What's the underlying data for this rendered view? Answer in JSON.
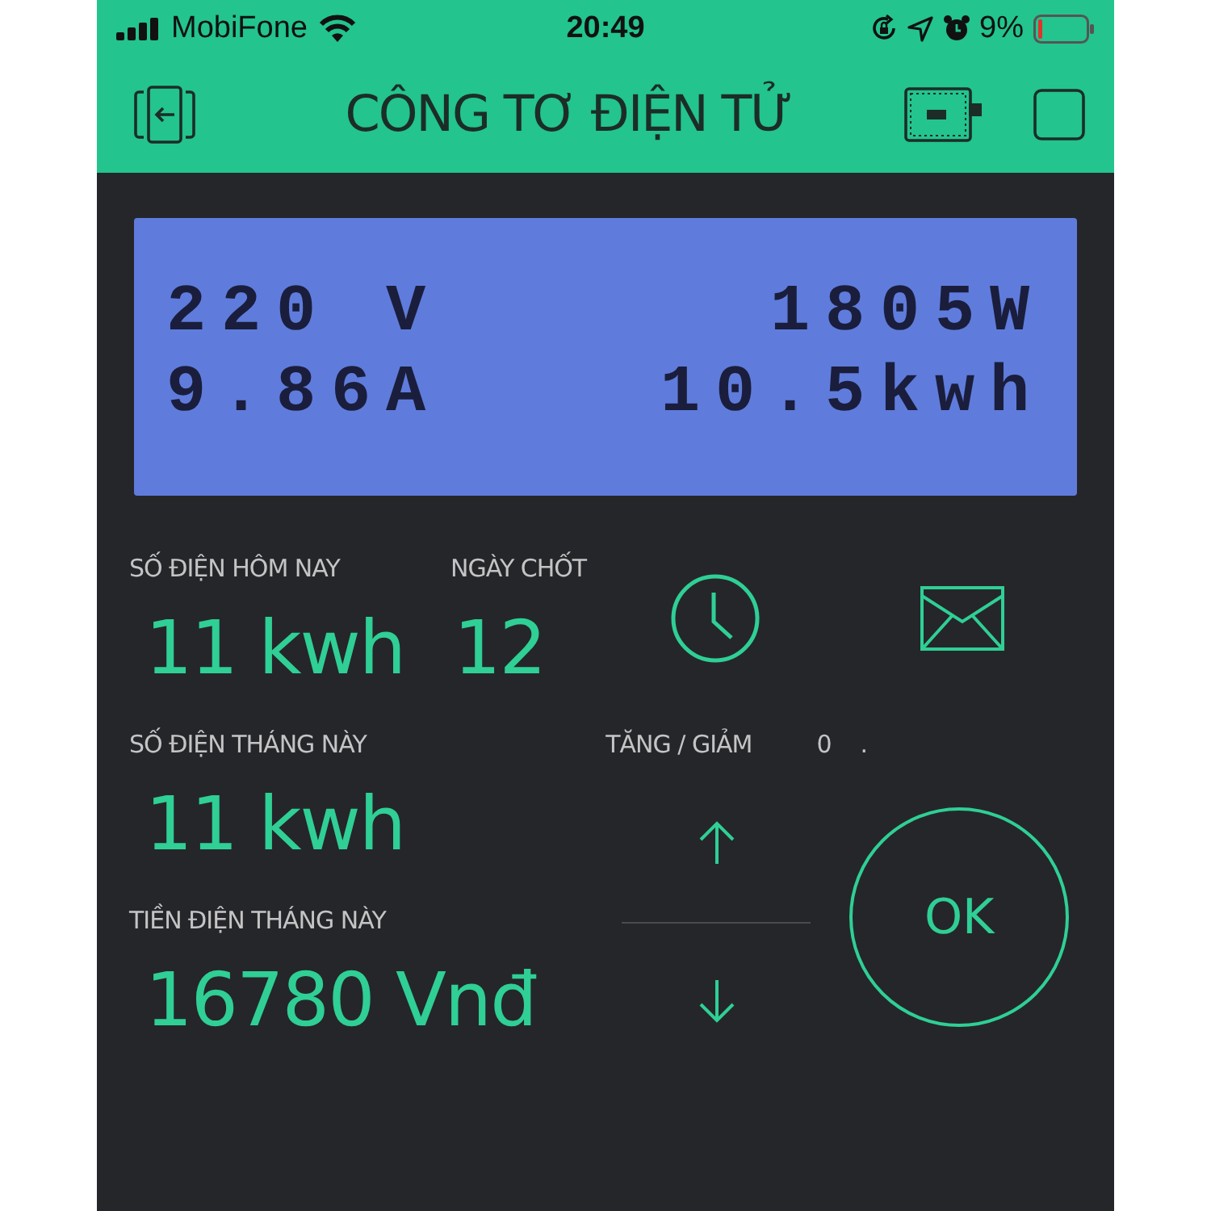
{
  "status_bar": {
    "carrier": "MobiFone",
    "time": "20:49",
    "battery_percent": "9%"
  },
  "header": {
    "title": "CÔNG TƠ ĐIỆN TỬ"
  },
  "lcd": {
    "lines": [
      "220 V      1805W",
      "9.86A    10.5kwh"
    ]
  },
  "today": {
    "label": "SỐ ĐIỆN HÔM NAY",
    "value": "11 kwh"
  },
  "closing_day": {
    "label": "NGÀY CHỐT",
    "value": "12"
  },
  "month": {
    "label": "SỐ ĐIỆN THÁNG NÀY",
    "value": "11 kwh"
  },
  "cost": {
    "label": "TIỀN ĐIỆN THÁNG NÀY",
    "value": "16780 Vnđ"
  },
  "step": {
    "label": "TĂNG / GIẢM",
    "value": "0",
    "suffix": "."
  },
  "ok_button": {
    "label": "OK"
  }
}
